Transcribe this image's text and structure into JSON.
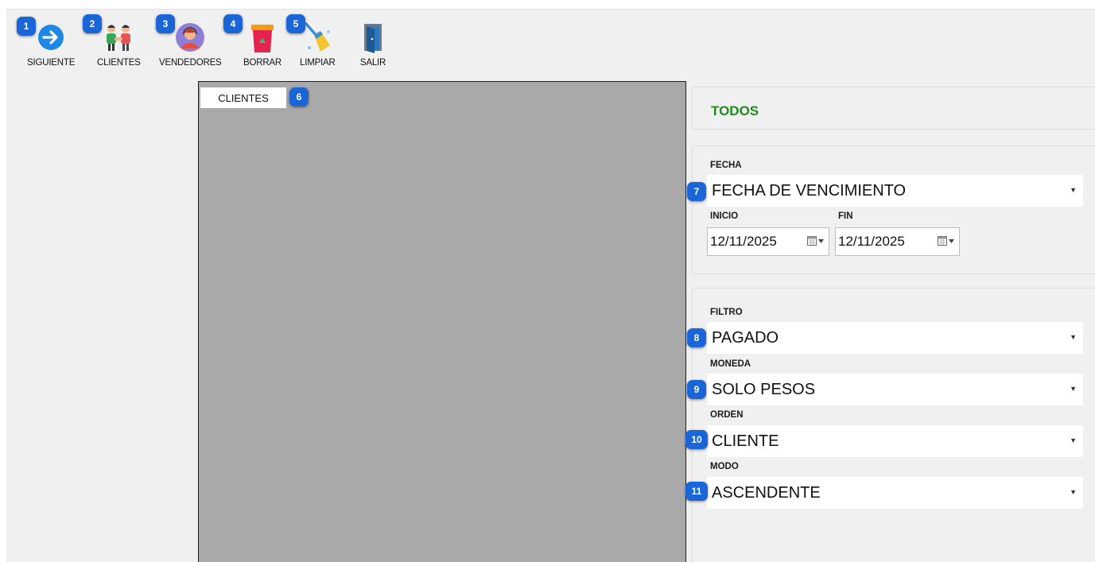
{
  "toolbar": {
    "buttons": [
      {
        "label": "SIGUIENTE",
        "icon": "arrow-right-circle-icon"
      },
      {
        "label": "CLIENTES",
        "icon": "clients-icon"
      },
      {
        "label": "VENDEDORES",
        "icon": "sales-agent-icon"
      },
      {
        "label": "BORRAR",
        "icon": "trash-bin-icon"
      },
      {
        "label": "LIMPIAR",
        "icon": "broom-icon"
      },
      {
        "label": "SALIR",
        "icon": "exit-door-icon"
      }
    ]
  },
  "grid": {
    "tab_label": "CLIENTES"
  },
  "right": {
    "title": "TODOS",
    "fecha": {
      "label": "FECHA",
      "value": "FECHA DE VENCIMIENTO",
      "inicio_label": "INICIO",
      "inicio_value": "12/11/2025",
      "fin_label": "FIN",
      "fin_value": "12/11/2025"
    },
    "filtro": {
      "label": "FILTRO",
      "value": "PAGADO"
    },
    "moneda": {
      "label": "MONEDA",
      "value": "SOLO PESOS"
    },
    "orden": {
      "label": "ORDEN",
      "value": "CLIENTE"
    },
    "modo": {
      "label": "MODO",
      "value": "ASCENDENTE"
    }
  },
  "markers": [
    "1",
    "2",
    "3",
    "4",
    "5",
    "6",
    "7",
    "8",
    "9",
    "10",
    "11"
  ],
  "colors": {
    "accent_title": "#1f8b1f",
    "marker": "#1a66d8",
    "grid_bg": "#a9a9a9",
    "window_bg": "#f0f0f0"
  }
}
